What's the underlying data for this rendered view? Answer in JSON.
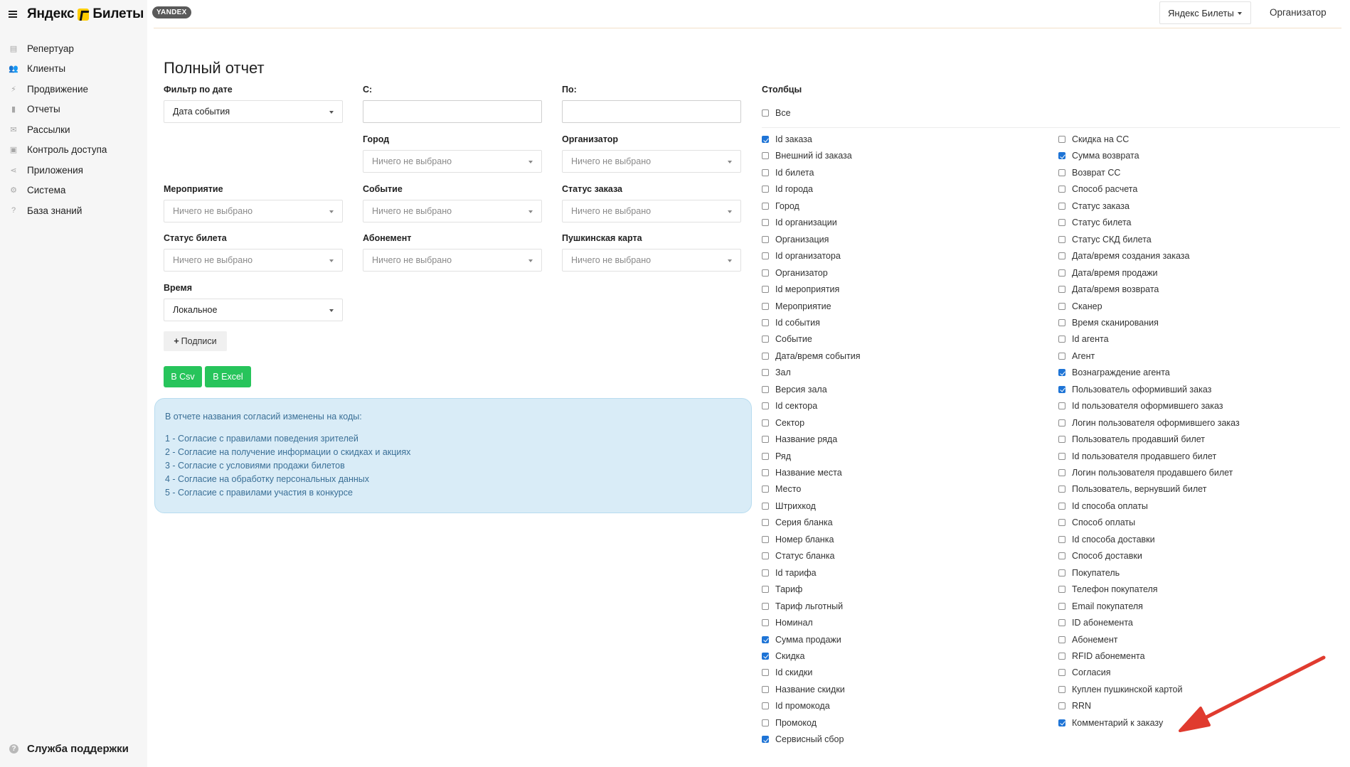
{
  "header": {
    "brand": "Яндекс",
    "brand_suffix": "Билеты",
    "badge": "YANDEX",
    "service_select": "Яндекс Билеты",
    "org_link": "Организатор"
  },
  "sidebar": {
    "items": [
      {
        "label": "Репертуар",
        "icon": "calendar-icon"
      },
      {
        "label": "Клиенты",
        "icon": "users-icon"
      },
      {
        "label": "Продвижение",
        "icon": "bolt-icon"
      },
      {
        "label": "Отчеты",
        "icon": "bar-chart-icon"
      },
      {
        "label": "Рассылки",
        "icon": "mail-icon"
      },
      {
        "label": "Контроль доступа",
        "icon": "id-card-icon"
      },
      {
        "label": "Приложения",
        "icon": "share-icon"
      },
      {
        "label": "Система",
        "icon": "gear-icon"
      },
      {
        "label": "База знаний",
        "icon": "help-icon"
      }
    ],
    "support": "Служба поддержки"
  },
  "main": {
    "title": "Полный отчет",
    "filters": {
      "date_filter": {
        "label": "Фильтр по дате",
        "value": "Дата события"
      },
      "from": {
        "label": "С:",
        "value": ""
      },
      "to": {
        "label": "По:",
        "value": ""
      },
      "city": {
        "label": "Город",
        "value": "Ничего не выбрано"
      },
      "organizer": {
        "label": "Организатор",
        "value": "Ничего не выбрано"
      },
      "event_group": {
        "label": "Мероприятие",
        "value": "Ничего не выбрано"
      },
      "event": {
        "label": "Событие",
        "value": "Ничего не выбрано"
      },
      "order_status": {
        "label": "Статус заказа",
        "value": "Ничего не выбрано"
      },
      "ticket_status": {
        "label": "Статус билета",
        "value": "Ничего не выбрано"
      },
      "subscription": {
        "label": "Абонемент",
        "value": "Ничего не выбрано"
      },
      "pushkin_card": {
        "label": "Пушкинская карта",
        "value": "Ничего не выбрано"
      },
      "time": {
        "label": "Время",
        "value": "Локальное"
      }
    },
    "signatures_button": "Подписи",
    "csv_button": "В Csv",
    "excel_button": "В Excel",
    "info": {
      "intro": "В отчете названия согласий изменены на коды:",
      "lines": [
        "1 - Согласие с правилами поведения зрителей",
        "2 - Согласие на получение информации о скидках и акциях",
        "3 - Согласие с условиями продажи билетов",
        "4 - Согласие на обработку персональных данных",
        "5 - Согласие с правилами участия в конкурсе"
      ]
    }
  },
  "columns": {
    "title": "Столбцы",
    "all_label": "Все",
    "all_checked": false,
    "left": [
      {
        "label": "Id заказа",
        "checked": true
      },
      {
        "label": "Внешний id заказа",
        "checked": false
      },
      {
        "label": "Id билета",
        "checked": false
      },
      {
        "label": "Id города",
        "checked": false
      },
      {
        "label": "Город",
        "checked": false
      },
      {
        "label": "Id организации",
        "checked": false
      },
      {
        "label": "Организация",
        "checked": false
      },
      {
        "label": "Id организатора",
        "checked": false
      },
      {
        "label": "Организатор",
        "checked": false
      },
      {
        "label": "Id мероприятия",
        "checked": false
      },
      {
        "label": "Мероприятие",
        "checked": false
      },
      {
        "label": "Id события",
        "checked": false
      },
      {
        "label": "Событие",
        "checked": false
      },
      {
        "label": "Дата/время события",
        "checked": false
      },
      {
        "label": "Зал",
        "checked": false
      },
      {
        "label": "Версия зала",
        "checked": false
      },
      {
        "label": "Id сектора",
        "checked": false
      },
      {
        "label": "Сектор",
        "checked": false
      },
      {
        "label": "Название ряда",
        "checked": false
      },
      {
        "label": "Ряд",
        "checked": false
      },
      {
        "label": "Название места",
        "checked": false
      },
      {
        "label": "Место",
        "checked": false
      },
      {
        "label": "Штрихкод",
        "checked": false
      },
      {
        "label": "Серия бланка",
        "checked": false
      },
      {
        "label": "Номер бланка",
        "checked": false
      },
      {
        "label": "Статус бланка",
        "checked": false
      },
      {
        "label": "Id тарифа",
        "checked": false
      },
      {
        "label": "Тариф",
        "checked": false
      },
      {
        "label": "Тариф льготный",
        "checked": false
      },
      {
        "label": "Номинал",
        "checked": false
      },
      {
        "label": "Сумма продажи",
        "checked": true
      },
      {
        "label": "Скидка",
        "checked": true
      },
      {
        "label": "Id скидки",
        "checked": false
      },
      {
        "label": "Название скидки",
        "checked": false
      },
      {
        "label": "Id промокода",
        "checked": false
      },
      {
        "label": "Промокод",
        "checked": false
      },
      {
        "label": "Сервисный сбор",
        "checked": true
      }
    ],
    "right": [
      {
        "label": "Скидка на СС",
        "checked": false
      },
      {
        "label": "Сумма возврата",
        "checked": true
      },
      {
        "label": "Возврат СС",
        "checked": false
      },
      {
        "label": "Способ расчета",
        "checked": false
      },
      {
        "label": "Статус заказа",
        "checked": false
      },
      {
        "label": "Статус билета",
        "checked": false
      },
      {
        "label": "Статус СКД билета",
        "checked": false
      },
      {
        "label": "Дата/время создания заказа",
        "checked": false
      },
      {
        "label": "Дата/время продажи",
        "checked": false
      },
      {
        "label": "Дата/время возврата",
        "checked": false
      },
      {
        "label": "Сканер",
        "checked": false
      },
      {
        "label": "Время сканирования",
        "checked": false
      },
      {
        "label": "Id агента",
        "checked": false
      },
      {
        "label": "Агент",
        "checked": false
      },
      {
        "label": "Вознаграждение агента",
        "checked": true
      },
      {
        "label": "Пользователь оформивший заказ",
        "checked": true
      },
      {
        "label": "Id пользователя оформившего заказ",
        "checked": false
      },
      {
        "label": "Логин пользователя оформившего заказ",
        "checked": false
      },
      {
        "label": "Пользователь продавший билет",
        "checked": false
      },
      {
        "label": "Id пользователя продавшего билет",
        "checked": false
      },
      {
        "label": "Логин пользователя продавшего билет",
        "checked": false
      },
      {
        "label": "Пользователь, вернувший билет",
        "checked": false
      },
      {
        "label": "Id способа оплаты",
        "checked": false
      },
      {
        "label": "Способ оплаты",
        "checked": false
      },
      {
        "label": "Id способа доставки",
        "checked": false
      },
      {
        "label": "Способ доставки",
        "checked": false
      },
      {
        "label": "Покупатель",
        "checked": false
      },
      {
        "label": "Телефон покупателя",
        "checked": false
      },
      {
        "label": "Email покупателя",
        "checked": false
      },
      {
        "label": "ID абонемента",
        "checked": false
      },
      {
        "label": "Абонемент",
        "checked": false
      },
      {
        "label": "RFID абонемента",
        "checked": false
      },
      {
        "label": "Согласия",
        "checked": false
      },
      {
        "label": "Куплен пушкинской картой",
        "checked": false
      },
      {
        "label": "RRN",
        "checked": false
      },
      {
        "label": "Комментарий к заказу",
        "checked": true
      }
    ]
  },
  "colors": {
    "accent_green": "#27c45b",
    "checkbox_blue": "#1e74d6",
    "info_bg": "#d9ecf7",
    "info_text": "#3a6f96",
    "annotation_arrow": "#e03b2f"
  }
}
